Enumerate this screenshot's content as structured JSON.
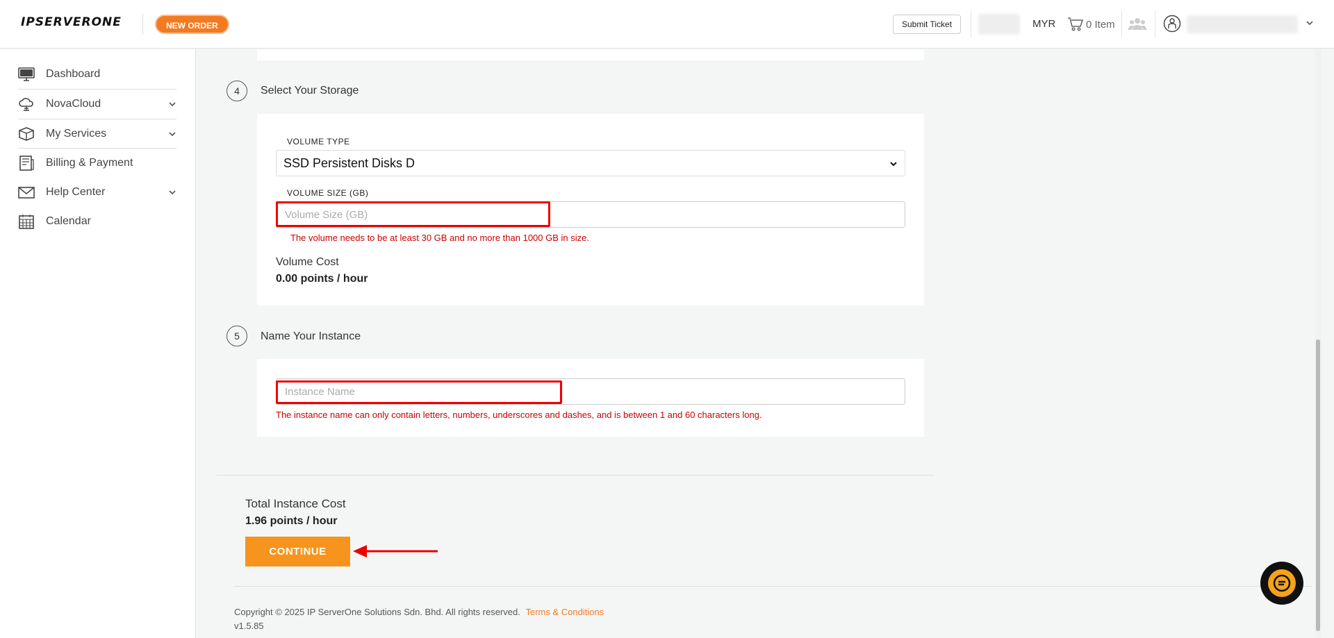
{
  "header": {
    "logo_text": "IPSERVERONE",
    "new_order_label": "NEW ORDER",
    "submit_ticket_label": "Submit Ticket",
    "currency": "MYR",
    "cart_label": "0 Item"
  },
  "sidebar": {
    "items": [
      {
        "label": "Dashboard",
        "icon": "monitor-icon",
        "expandable": false
      },
      {
        "label": "NovaCloud",
        "icon": "cloud-icon",
        "expandable": true
      },
      {
        "label": "My Services",
        "icon": "box-icon",
        "expandable": true
      },
      {
        "label": "Billing & Payment",
        "icon": "receipt-icon",
        "expandable": false
      },
      {
        "label": "Help Center",
        "icon": "mail-icon",
        "expandable": true
      },
      {
        "label": "Calendar",
        "icon": "calendar-icon",
        "expandable": false
      }
    ]
  },
  "storage": {
    "step_number": "4",
    "title": "Select Your Storage",
    "volume_type_label": "VOLUME TYPE",
    "volume_type_value": "SSD Persistent Disks D",
    "volume_size_label": "VOLUME SIZE (GB)",
    "volume_size_placeholder": "Volume Size (GB)",
    "volume_size_error": "The volume needs to be at least 30 GB and no more than 1000 GB in size.",
    "cost_label": "Volume Cost",
    "cost_value": "0.00 points / hour"
  },
  "instance": {
    "step_number": "5",
    "title": "Name Your Instance",
    "name_placeholder": "Instance Name",
    "name_error": "The instance name can only contain letters, numbers, underscores and dashes, and is between 1 and 60 characters long."
  },
  "total": {
    "label": "Total Instance Cost",
    "value": "1.96 points / hour",
    "continue_label": "CONTINUE"
  },
  "footer": {
    "copyright": "Copyright © 2025 IP ServerOne Solutions Sdn. Bhd. All rights reserved.",
    "terms_link": "Terms & Conditions",
    "version": "v1.5.85"
  },
  "colors": {
    "accent": "#f7941d",
    "error": "#cc0000",
    "highlight": "#ee0000"
  }
}
